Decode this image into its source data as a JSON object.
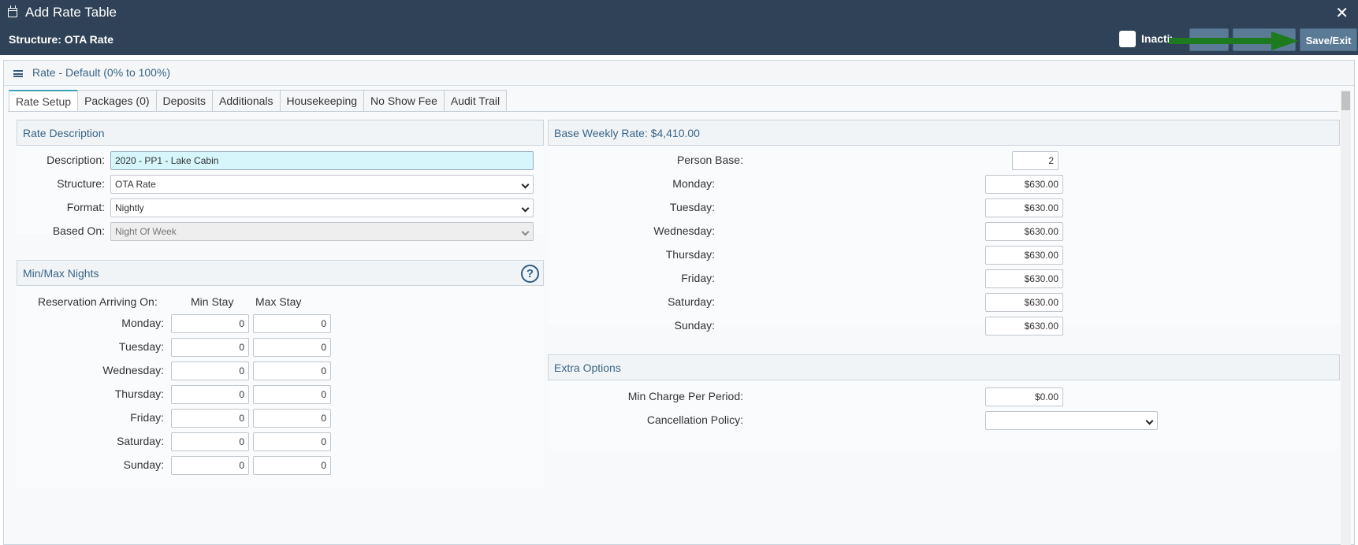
{
  "titlebar": {
    "title": "Add Rate Table",
    "structure_label": "Structure: OTA Rate",
    "inactive_label": "Inactive",
    "save_label": "Save/Exit"
  },
  "panel": {
    "title": "Rate - Default (0% to 100%)"
  },
  "tabs": [
    {
      "label": "Rate Setup"
    },
    {
      "label": "Packages (0)"
    },
    {
      "label": "Deposits"
    },
    {
      "label": "Additionals"
    },
    {
      "label": "Housekeeping"
    },
    {
      "label": "No Show Fee"
    },
    {
      "label": "Audit Trail"
    }
  ],
  "rate_description": {
    "header": "Rate Description",
    "description_label": "Description:",
    "description_value": "2020 - PP1 - Lake Cabin",
    "structure_label": "Structure:",
    "structure_value": "OTA Rate",
    "format_label": "Format:",
    "format_value": "Nightly",
    "based_on_label": "Based On:",
    "based_on_value": "Night Of Week"
  },
  "minmax": {
    "header": "Min/Max Nights",
    "arriving_label": "Reservation Arriving On:",
    "min_label": "Min Stay",
    "max_label": "Max Stay",
    "rows": [
      {
        "day": "Monday:",
        "min": "0",
        "max": "0"
      },
      {
        "day": "Tuesday:",
        "min": "0",
        "max": "0"
      },
      {
        "day": "Wednesday:",
        "min": "0",
        "max": "0"
      },
      {
        "day": "Thursday:",
        "min": "0",
        "max": "0"
      },
      {
        "day": "Friday:",
        "min": "0",
        "max": "0"
      },
      {
        "day": "Saturday:",
        "min": "0",
        "max": "0"
      },
      {
        "day": "Sunday:",
        "min": "0",
        "max": "0"
      }
    ]
  },
  "base_weekly": {
    "header": "Base Weekly Rate: $4,410.00",
    "person_base_label": "Person Base:",
    "person_base_value": "2",
    "rows": [
      {
        "day": "Monday:",
        "value": "$630.00"
      },
      {
        "day": "Tuesday:",
        "value": "$630.00"
      },
      {
        "day": "Wednesday:",
        "value": "$630.00"
      },
      {
        "day": "Thursday:",
        "value": "$630.00"
      },
      {
        "day": "Friday:",
        "value": "$630.00"
      },
      {
        "day": "Saturday:",
        "value": "$630.00"
      },
      {
        "day": "Sunday:",
        "value": "$630.00"
      }
    ]
  },
  "extra_options": {
    "header": "Extra Options",
    "min_charge_label": "Min Charge Per Period:",
    "min_charge_value": "$0.00",
    "cancellation_label": "Cancellation Policy:",
    "cancellation_value": ""
  },
  "colors": {
    "titlebar_bg": "#2f4257",
    "accent": "#3a6587",
    "arrow": "#1e7a1e",
    "highlight_input": "#d6f6fb"
  }
}
